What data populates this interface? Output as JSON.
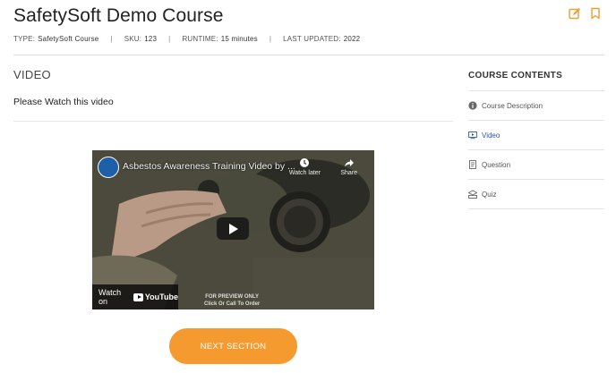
{
  "header": {
    "title": "SafetySoft Demo Course",
    "meta": [
      {
        "label": "TYPE:",
        "value": "SafetySoft Course"
      },
      {
        "label": "SKU:",
        "value": "123"
      },
      {
        "label": "RUNTIME:",
        "value": "15 minutes"
      },
      {
        "label": "LAST UPDATED:",
        "value": "2022"
      }
    ],
    "icons": [
      "edit-icon",
      "bookmark-icon"
    ],
    "accent": "#f59a2e"
  },
  "main": {
    "section_title": "VIDEO",
    "instruction": "Please Watch this video",
    "video": {
      "title": "Asbestos Awareness Training Video by ...",
      "watch_later": "Watch later",
      "share": "Share",
      "watch_on": "Watch on",
      "youtube": "YouTube",
      "note_line1": "FOR PREVIEW ONLY",
      "note_line2": "Click Or Call To Order"
    },
    "next_button": "NEXT SECTION"
  },
  "sidebar": {
    "title": "COURSE CONTENTS",
    "items": [
      {
        "label": "Course Description",
        "icon": "info-icon",
        "active": false
      },
      {
        "label": "Video",
        "icon": "video-icon",
        "active": true
      },
      {
        "label": "Question",
        "icon": "document-icon",
        "active": false
      },
      {
        "label": "Quiz",
        "icon": "quiz-icon",
        "active": false
      }
    ],
    "active_color": "#2a5a9a"
  }
}
